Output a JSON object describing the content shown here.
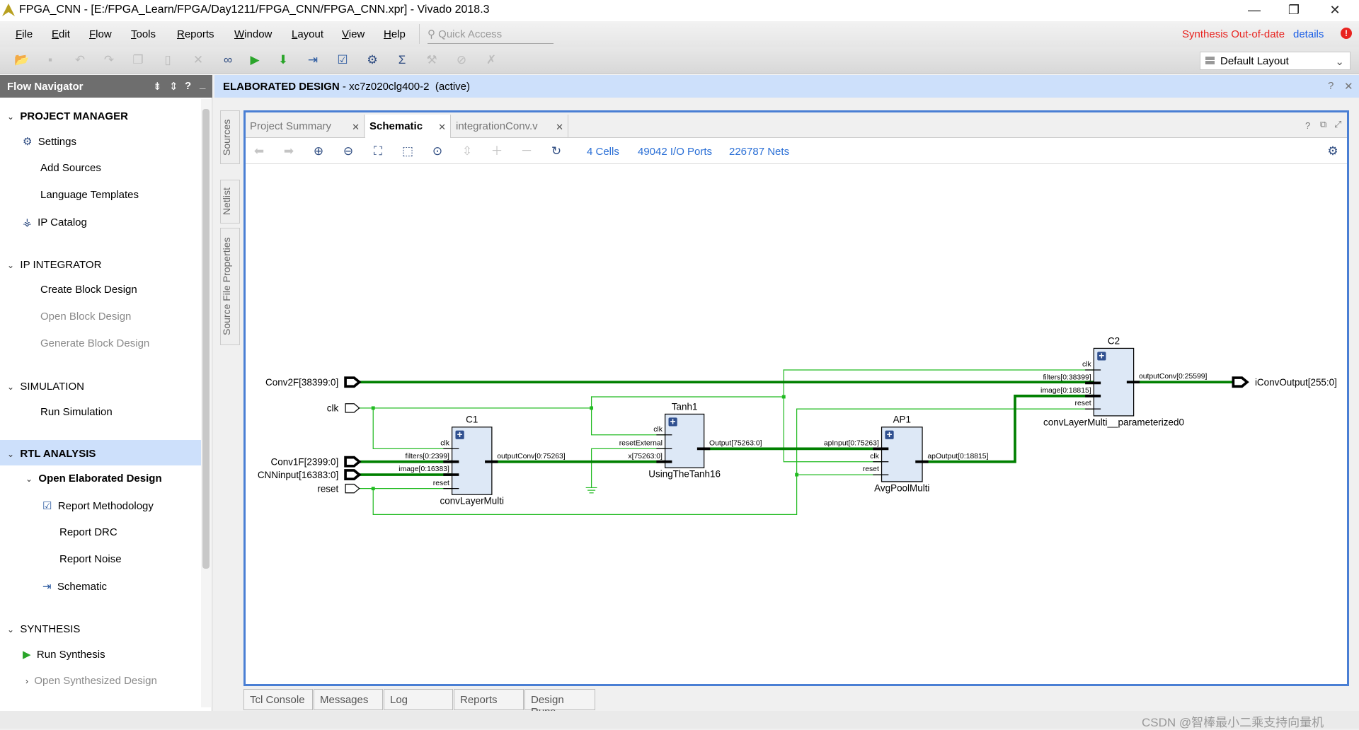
{
  "window": {
    "title": "FPGA_CNN - [E:/FPGA_Learn/FPGA/Day1211/FPGA_CNN/FPGA_CNN.xpr] - Vivado 2018.3",
    "minimize": "—",
    "restore": "❐",
    "close": "✕"
  },
  "menu": [
    "File",
    "Edit",
    "Flow",
    "Tools",
    "Reports",
    "Window",
    "Layout",
    "View",
    "Help"
  ],
  "quick_access": {
    "placeholder": "Quick Access",
    "icon": "search-icon"
  },
  "status": {
    "synthesis": "Synthesis Out-of-date",
    "details": "details",
    "alert_icon": "!",
    "colors": {
      "warning": "#e8231f",
      "link": "#1a5ee6"
    }
  },
  "layout_select": {
    "value": "Default Layout"
  },
  "flow_navigator": {
    "title": "Flow Navigator",
    "sections": [
      {
        "label": "PROJECT MANAGER",
        "items": [
          "Settings",
          "Add Sources",
          "Language Templates",
          "IP Catalog"
        ]
      },
      {
        "label": "IP INTEGRATOR",
        "items": [
          "Create Block Design",
          "Open Block Design",
          "Generate Block Design"
        ]
      },
      {
        "label": "SIMULATION",
        "items": [
          "Run Simulation"
        ]
      },
      {
        "label": "RTL ANALYSIS",
        "items": [
          "Open Elaborated Design",
          "Report Methodology",
          "Report DRC",
          "Report Noise",
          "Schematic"
        ]
      },
      {
        "label": "SYNTHESIS",
        "items": [
          "Run Synthesis",
          "Open Synthesized Design"
        ]
      }
    ]
  },
  "design_header": {
    "title": "ELABORATED DESIGN",
    "part": " - xc7z020clg400-2",
    "state": "(active)"
  },
  "side_tabs": [
    "Sources",
    "Netlist",
    "Source File Properties"
  ],
  "tabs": [
    {
      "label": "Project Summary"
    },
    {
      "label": "Schematic",
      "active": true
    },
    {
      "label": "integrationConv.v"
    }
  ],
  "schematic_toolbar": {
    "cells": "4 Cells",
    "ports": "49042 I/O Ports",
    "nets": "226787 Nets"
  },
  "schematic": {
    "ports_in": [
      "Conv2F[38399:0]",
      "clk",
      "Conv1F[2399:0]",
      "CNNinput[16383:0]",
      "reset"
    ],
    "port_out": "iConvOutput[255:0]",
    "cells": [
      {
        "inst": "C1",
        "type": "convLayerMulti",
        "pins_in": [
          "clk",
          "filters[0:2399]",
          "image[0:16383]",
          "reset"
        ],
        "pins_out": [
          "outputConv[0:75263]"
        ]
      },
      {
        "inst": "Tanh1",
        "type": "UsingTheTanh16",
        "pins_in": [
          "clk",
          "resetExternal",
          "x[75263:0]"
        ],
        "pins_out": [
          "Output[75263:0]"
        ]
      },
      {
        "inst": "AP1",
        "type": "AvgPoolMulti",
        "pins_in": [
          "apInput[0:75263]",
          "clk",
          "reset"
        ],
        "pins_out": [
          "apOutput[0:18815]"
        ]
      },
      {
        "inst": "C2",
        "type": "convLayerMulti__parameterized0",
        "pins_in": [
          "clk",
          "filters[0:38399]",
          "image[0:18815]",
          "reset"
        ],
        "pins_out": [
          "outputConv[0:25599]"
        ]
      }
    ],
    "colors": {
      "bus": "#008000",
      "net": "#22bb22",
      "cell_fill": "#dde8f6"
    }
  },
  "bottom_tabs": [
    "Tcl Console",
    "Messages",
    "Log",
    "Reports",
    "Design Runs"
  ],
  "watermark": "CSDN @智棒最小二乘支持向量机"
}
